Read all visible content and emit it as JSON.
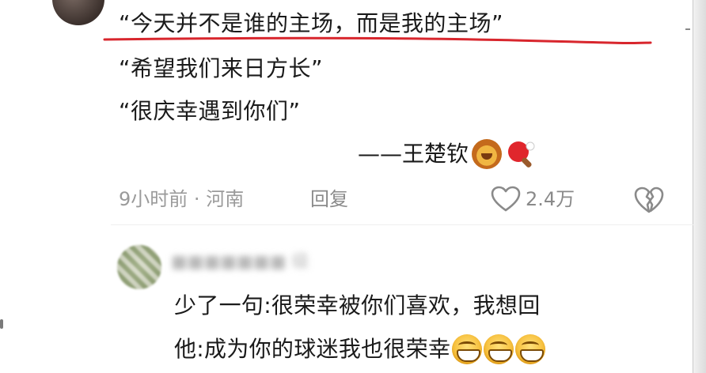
{
  "comment": {
    "lines": [
      "“今天并不是谁的主场，而是我的主场”",
      "“希望我们来日方长”",
      "“很庆幸遇到你们”"
    ],
    "signature": "——王楚钦",
    "signature_emojis": [
      "lion-emoji",
      "ping-pong-emoji"
    ],
    "underline_color": "#d8262d",
    "time": "9小时前",
    "separator": "·",
    "location": "河南",
    "reply_label": "回复",
    "likes": "2.4万"
  },
  "reply": {
    "lines": [
      "少了一句:很荣幸被你们喜欢，我想回",
      "他:成为你的球迷我也很荣幸"
    ],
    "emoji_count": 3,
    "emoji": "grinning-emoji"
  }
}
